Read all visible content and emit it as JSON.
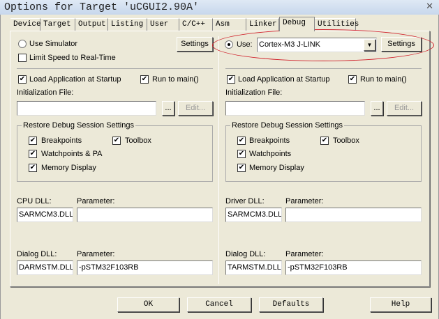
{
  "window": {
    "title": "Options for Target 'uCGUI2.90A'",
    "close_icon": "close-icon"
  },
  "tabs": [
    "Device",
    "Target",
    "Output",
    "Listing",
    "User",
    "C/C++",
    "Asm",
    "Linker",
    "Debug",
    "Utilities"
  ],
  "active_tab": "Debug",
  "left": {
    "use_simulator": "Use Simulator",
    "use_simulator_selected": false,
    "limit_speed": "Limit Speed to Real-Time",
    "limit_speed_checked": false,
    "settings": "Settings",
    "load_app": "Load Application at Startup",
    "run_to_main": "Run to main()",
    "init_file_label": "Initialization File:",
    "init_file_value": "",
    "browse": "...",
    "edit": "Edit...",
    "restore_group": "Restore Debug Session Settings",
    "breakpoints": "Breakpoints",
    "toolbox": "Toolbox",
    "watchpoints": "Watchpoints & PA",
    "memory": "Memory Display",
    "cpu_dll_label": "CPU DLL:",
    "cpu_dll_value": "SARMCM3.DLL",
    "param_label": "Parameter:",
    "cpu_param_value": "",
    "dialog_dll_label": "Dialog DLL:",
    "dialog_dll_value": "DARMSTM.DLL",
    "dialog_param_value": "-pSTM32F103RB"
  },
  "right": {
    "use": "Use:",
    "use_selected": true,
    "driver": "Cortex-M3 J-LINK",
    "settings": "Settings",
    "load_app": "Load Application at Startup",
    "run_to_main": "Run to main()",
    "init_file_label": "Initialization File:",
    "init_file_value": "",
    "browse": "...",
    "edit": "Edit...",
    "restore_group": "Restore Debug Session Settings",
    "breakpoints": "Breakpoints",
    "toolbox": "Toolbox",
    "watchpoints": "Watchpoints",
    "memory": "Memory Display",
    "driver_dll_label": "Driver DLL:",
    "driver_dll_value": "SARMCM3.DLL",
    "param_label": "Parameter:",
    "driver_param_value": "",
    "dialog_dll_label": "Dialog DLL:",
    "dialog_dll_value": "TARMSTM.DLL",
    "dialog_param_value": "-pSTM32F103RB"
  },
  "footer": {
    "ok": "OK",
    "cancel": "Cancel",
    "defaults": "Defaults",
    "help": "Help"
  },
  "colors": {
    "highlight_ellipse": "#d0202a"
  }
}
